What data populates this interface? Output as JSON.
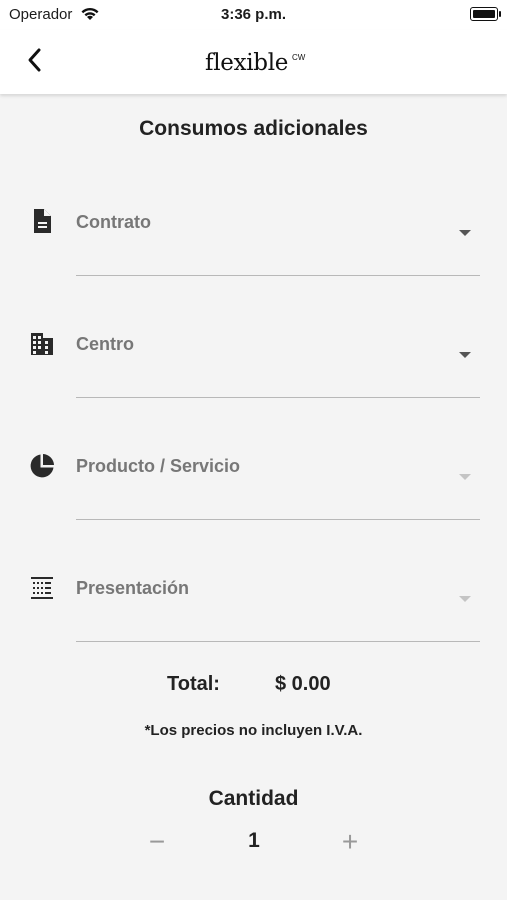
{
  "status_bar": {
    "carrier": "Operador",
    "time": "3:36 p.m."
  },
  "nav": {
    "logo": "flexible",
    "logo_sup": "CW"
  },
  "page": {
    "title": "Consumos adicionales"
  },
  "fields": [
    {
      "label": "Contrato",
      "icon": "document-icon",
      "enabled": true
    },
    {
      "label": "Centro",
      "icon": "building-icon",
      "enabled": true
    },
    {
      "label": "Producto / Servicio",
      "icon": "pie-chart-icon",
      "enabled": false
    },
    {
      "label": "Presentación",
      "icon": "grid-list-icon",
      "enabled": false
    }
  ],
  "total": {
    "label": "Total:",
    "value": "$ 0.00"
  },
  "disclaimer": "*Los precios no incluyen I.V.A.",
  "quantity": {
    "title": "Cantidad",
    "value": "1",
    "minus": "−",
    "plus": "+"
  }
}
